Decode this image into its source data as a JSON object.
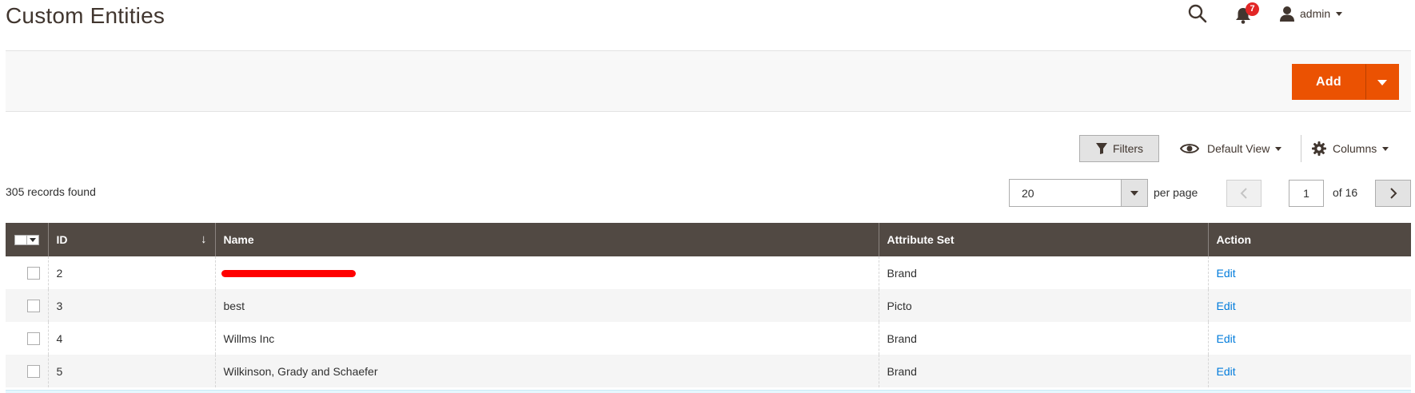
{
  "page": {
    "title": "Custom Entities"
  },
  "header": {
    "notifications_count": "7",
    "user_name": "admin",
    "icons": [
      "search-icon",
      "bell-icon",
      "user-icon"
    ]
  },
  "actions": {
    "add_label": "Add"
  },
  "grid_controls": {
    "filters_label": "Filters",
    "view_label": "Default View",
    "columns_label": "Columns"
  },
  "records_text": "305 records found",
  "pagination": {
    "per_page_value": "20",
    "per_page_label": "per page",
    "current_page": "1",
    "of_label": "of 16"
  },
  "table": {
    "columns": [
      "ID",
      "Name",
      "Attribute Set",
      "Action"
    ],
    "sort": {
      "column": "ID",
      "direction": "descending-arrow"
    },
    "rows": [
      {
        "id": "2",
        "name": "",
        "name_redacted": true,
        "attribute_set": "Brand",
        "action": "Edit"
      },
      {
        "id": "3",
        "name": "best",
        "attribute_set": "Picto",
        "action": "Edit"
      },
      {
        "id": "4",
        "name": "Willms Inc",
        "attribute_set": "Brand",
        "action": "Edit"
      },
      {
        "id": "5",
        "name": "Wilkinson, Grady and Schaefer",
        "attribute_set": "Brand",
        "action": "Edit"
      }
    ]
  },
  "colors": {
    "accent": "#eb5202",
    "header_bg": "#514943",
    "link": "#007bdb",
    "badge": "#e22626"
  }
}
